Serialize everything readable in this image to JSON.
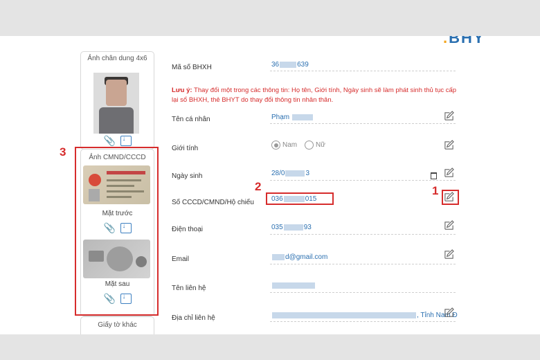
{
  "header": {
    "logo_text": "BHY",
    "logo_prefix": "."
  },
  "left_panel": {
    "portrait_title": "Ảnh chân dung 4x6",
    "cccd_title": "Ảnh CMND/CCCD",
    "front_caption": "Mặt trước",
    "back_caption": "Mặt sau",
    "other_title": "Giấy tờ khác",
    "clip_icon": "📎"
  },
  "annotations": {
    "n1": "1",
    "n2": "2",
    "n3": "3",
    "color": "#d62c2c"
  },
  "form": {
    "bhxh_label": "Mã số BHXH",
    "bhxh_prefix": "36",
    "bhxh_suffix": "639",
    "note_bold": "Lưu ý:",
    "note_text": " Thay đổi một trong các thông tin: Họ tên, Giới tính, Ngày sinh sẽ làm phát sinh thủ tục cấp lại sổ BHXH, thẻ BHYT do thay đổi thông tin nhân thân.",
    "name_label": "Tên cá nhân",
    "name_prefix": "Phạm",
    "gender_label": "Giới tính",
    "gender_male": "Nam",
    "gender_female": "Nữ",
    "dob_label": "Ngày sinh",
    "dob_prefix": "28/0",
    "dob_suffix": "3",
    "id_label": "Số CCCD/CMND/Hộ chiếu",
    "id_prefix": "036",
    "id_suffix": "015",
    "phone_label": "Điện thoại",
    "phone_prefix": "035",
    "phone_suffix": "93",
    "email_label": "Email",
    "email_suffix": "d@gmail.com",
    "contact_label": "Tên liên hệ",
    "address_label": "Địa chỉ liên hệ",
    "address_suffix": ", Tỉnh Nam Đ"
  }
}
